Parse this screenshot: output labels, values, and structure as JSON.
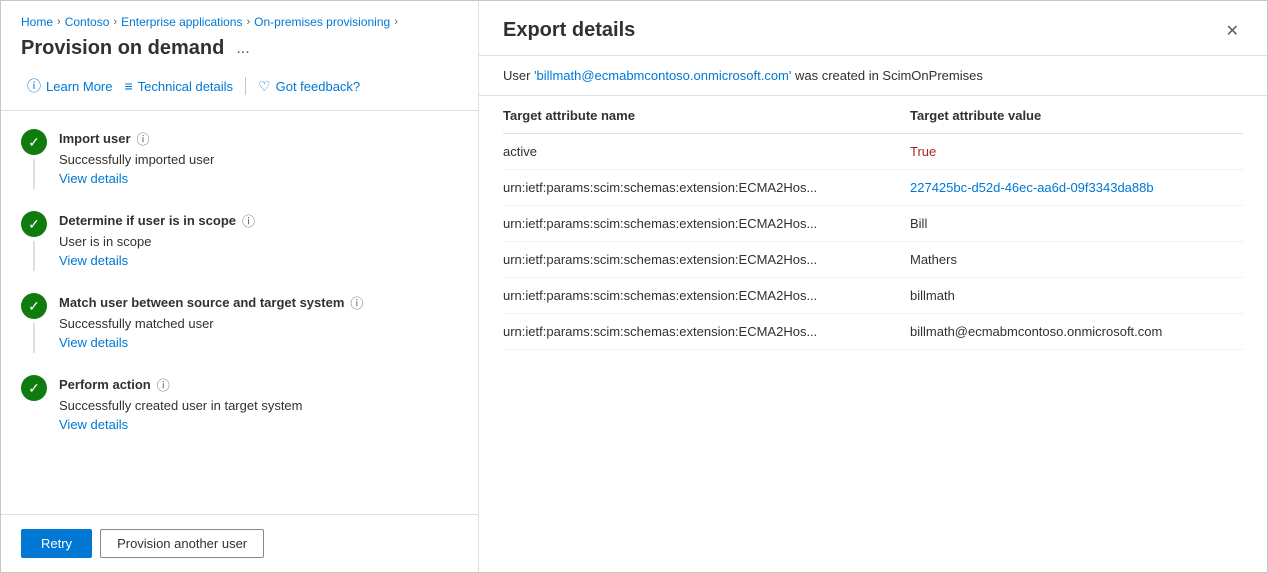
{
  "breadcrumb": {
    "items": [
      {
        "label": "Home",
        "link": true
      },
      {
        "label": "Contoso",
        "link": true
      },
      {
        "label": "Enterprise applications",
        "link": true
      },
      {
        "label": "On-premises provisioning",
        "link": true
      }
    ]
  },
  "left_panel": {
    "title": "Provision on demand",
    "ellipsis": "...",
    "toolbar": {
      "learn_more": "Learn More",
      "technical_details": "Technical details",
      "got_feedback": "Got feedback?"
    },
    "steps": [
      {
        "title": "Import user",
        "desc": "Successfully imported user",
        "view_details": "View details"
      },
      {
        "title": "Determine if user is in scope",
        "desc": "User is in scope",
        "view_details": "View details"
      },
      {
        "title": "Match user between source and target system",
        "desc": "Successfully matched user",
        "view_details": "View details"
      },
      {
        "title": "Perform action",
        "desc": "Successfully created user in target system",
        "view_details": "View details"
      }
    ],
    "buttons": {
      "retry": "Retry",
      "provision_another": "Provision another user"
    }
  },
  "right_panel": {
    "title": "Export details",
    "close_icon": "✕",
    "status_prefix": "User ",
    "status_user": "'billmath@ecmabmcontoso.onmicrosoft.com'",
    "status_suffix": " was created in ScimOnPremises",
    "table": {
      "col1_header": "Target attribute name",
      "col2_header": "Target attribute value",
      "rows": [
        {
          "attr": "active",
          "value": "True",
          "value_type": "red"
        },
        {
          "attr": "urn:ietf:params:scim:schemas:extension:ECMA2Hos...",
          "value": "227425bc-d52d-46ec-aa6d-09f3343da88b",
          "value_type": "blue"
        },
        {
          "attr": "urn:ietf:params:scim:schemas:extension:ECMA2Hos...",
          "value": "Bill",
          "value_type": "plain"
        },
        {
          "attr": "urn:ietf:params:scim:schemas:extension:ECMA2Hos...",
          "value": "Mathers",
          "value_type": "plain"
        },
        {
          "attr": "urn:ietf:params:scim:schemas:extension:ECMA2Hos...",
          "value": "billmath",
          "value_type": "plain"
        },
        {
          "attr": "urn:ietf:params:scim:schemas:extension:ECMA2Hos...",
          "value": "billmath@ecmabmcontoso.onmicrosoft.com",
          "value_type": "plain"
        }
      ]
    }
  }
}
